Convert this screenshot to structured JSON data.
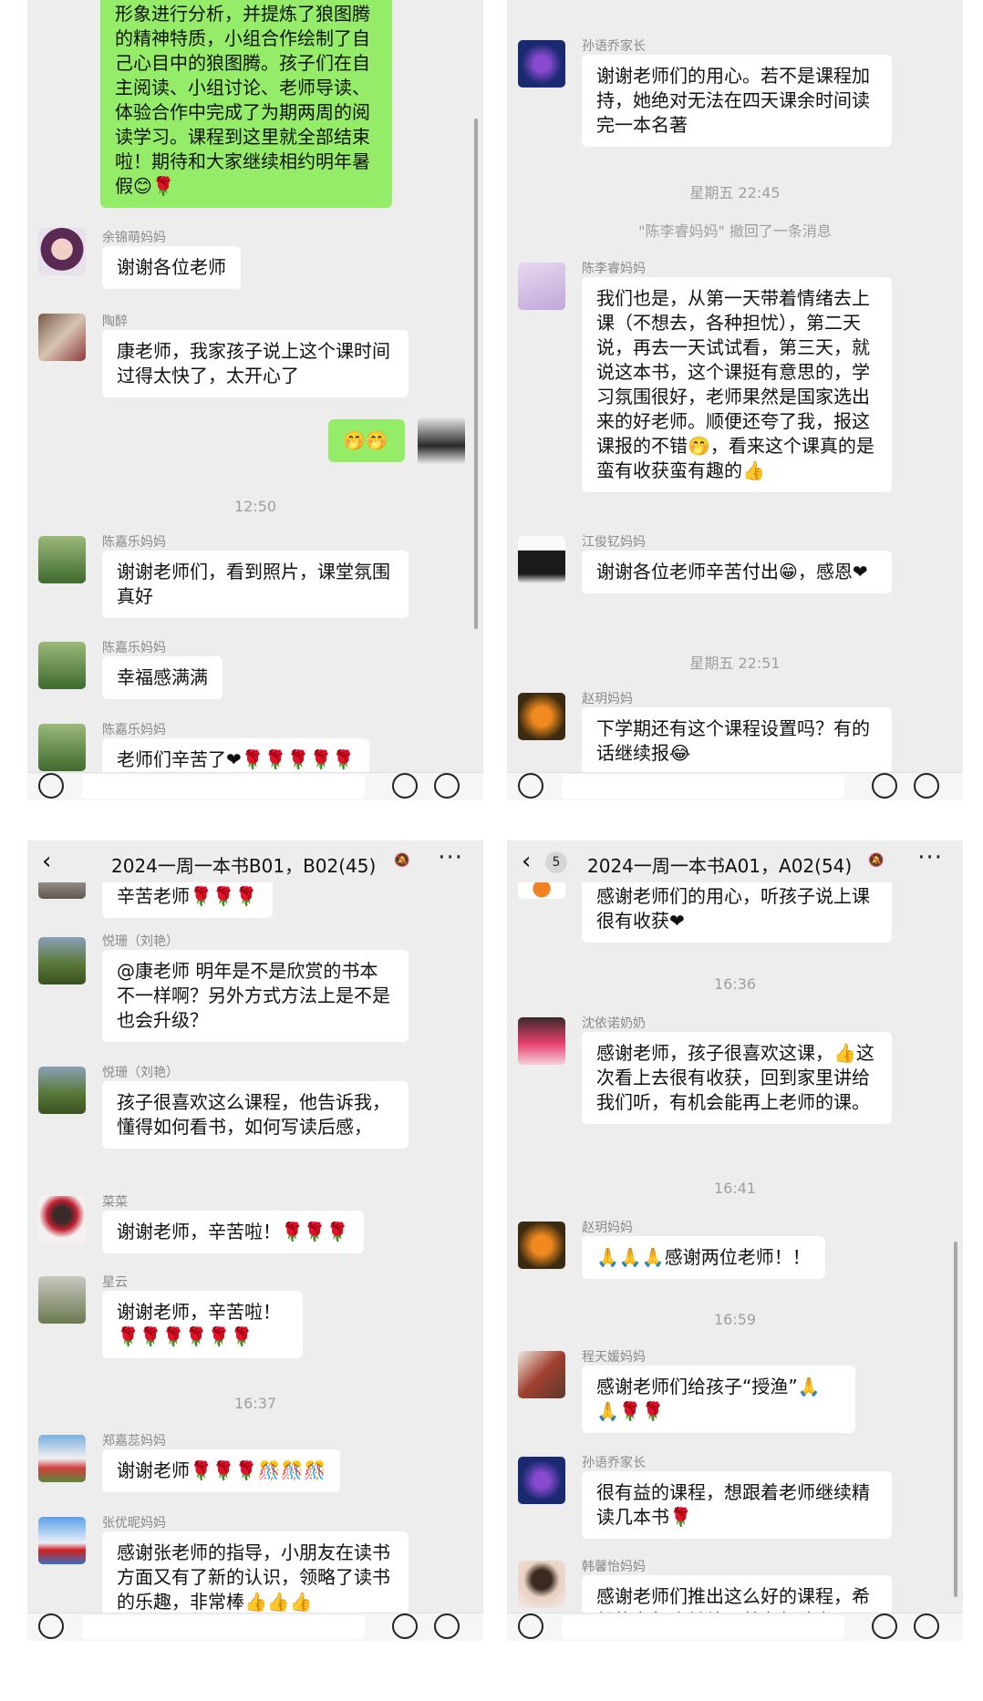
{
  "colors": {
    "panel_bg": "#ededed",
    "my_bubble": "#95ec69",
    "their_bubble": "#ffffff"
  },
  "icons": {
    "heart": "heart-icon",
    "rose": "rose-icon",
    "thumbs": "thumbs-up-icon"
  },
  "p1": {
    "m1": "形象进行分析，并提炼了狼图腾的精神特质，小组合作绘制了自己心目中的狼图腾。孩子们在自主阅读、小组讨论、老师导读、体验合作中完成了为期两周的阅读学习。课程到这里就全部结束啦！期待和大家继续相约明年暑假😊🌹",
    "m2_name": "余锦萌妈妈",
    "m2": "谢谢各位老师",
    "m3_name": "陶醉",
    "m3": "康老师，我家孩子说上这个课时间过得太快了，太开心了",
    "m4": "🤭🤭",
    "time1": "12:50",
    "m5_name": "陈嘉乐妈妈",
    "m5": "谢谢老师们，看到照片，课堂氛围真好",
    "m6_name": "陈嘉乐妈妈",
    "m6": "幸福感满满",
    "m7_name": "陈嘉乐妈妈",
    "m7": "老师们辛苦了❤🌹🌹🌹🌹🌹"
  },
  "p2": {
    "m1_name": "孙语乔家长",
    "m1": "谢谢老师们的用心。若不是课程加持，她绝对无法在四天课余时间读完一本名著",
    "time1": "星期五 22:45",
    "sys1": "\"陈李睿妈妈\" 撤回了一条消息",
    "m2_name": "陈李睿妈妈",
    "m2": "我们也是，从第一天带着情绪去上课（不想去，各种担忧），第二天说，再去一天试试看，第三天，就说这本书，这个课挺有意思的，学习氛围很好，老师果然是国家选出来的好老师。顺便还夸了我，报这课报的不错🤭，看来这个课真的是蛮有收获蛮有趣的👍",
    "m3_name": "江俊钇妈妈",
    "m3": "谢谢各位老师辛苦付出😁，感恩❤",
    "time2": "星期五 22:51",
    "m4_name": "赵玥妈妈",
    "m4": "下学期还有这个课程设置吗？有的话继续报😂"
  },
  "p3": {
    "title": "2024一周一本书B01，B02(45)",
    "m0": "辛苦老师🌹🌹🌹",
    "m1_name": "悦珊（刘艳）",
    "m1": "@康老师 明年是不是欣赏的书本不一样啊？另外方式方法上是不是也会升级？",
    "m2_name": "悦珊（刘艳）",
    "m2": "孩子很喜欢这么课程，他告诉我，懂得如何看书，如何写读后感，",
    "m3_name": "菜菜",
    "m3": "谢谢老师，辛苦啦！🌹🌹🌹",
    "m4_name": "星云",
    "m4": "谢谢老师，辛苦啦！🌹🌹🌹🌹🌹🌹",
    "time1": "16:37",
    "m5_name": "郑嘉蕊妈妈",
    "m5": "谢谢老师🌹🌹🌹🎊🎊🎊",
    "m6_name": "张优昵妈妈",
    "m6": "感谢张老师的指导，小朋友在读书方面又有了新的认识，领略了读书的乐趣，非常棒👍👍👍"
  },
  "p4": {
    "badge": "5",
    "title": "2024一周一本书A01，A02(54)",
    "m0": "感谢老师们的用心，听孩子说上课很有收获❤",
    "time1": "16:36",
    "m1_name": "沈依诺奶奶",
    "m1": "感谢老师，孩子很喜欢这课，👍这次看上去很有收获，回到家里讲给我们听，有机会能再上老师的课。",
    "time2": "16:41",
    "m2_name": "赵玥妈妈",
    "m2": "🙏🙏🙏感谢两位老师！！",
    "time3": "16:59",
    "m3_name": "程天媛妈妈",
    "m3": "感谢老师们给孩子“授渔”🙏🙏🌹🌹",
    "m4_name": "孙语乔家长",
    "m4": "很有益的课程，想跟着老师继续精读几本书🌹",
    "m5_name": "韩馨怡妈妈",
    "m5": "感谢老师们推出这么好的课程，希望能有机会继续跟着老师读书"
  }
}
